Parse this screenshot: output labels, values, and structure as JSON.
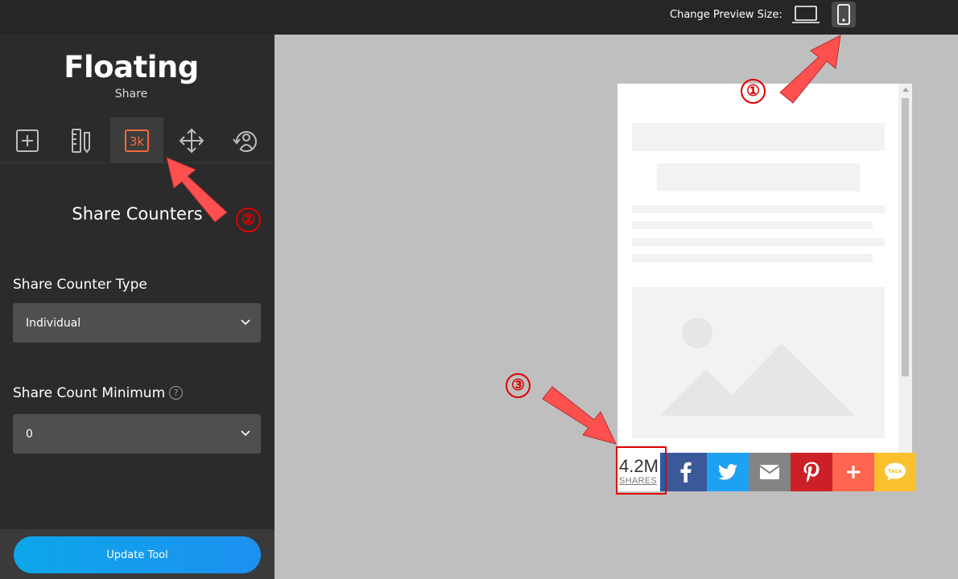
{
  "topbar": {
    "preview_label": "Change Preview Size:",
    "devices": [
      {
        "name": "laptop",
        "icon": "laptop-icon"
      },
      {
        "name": "mobile",
        "icon": "mobile-icon",
        "active": true
      }
    ]
  },
  "sidebar": {
    "title": "Floating",
    "subtitle": "Share",
    "tabs": [
      {
        "icon": "add-box-icon"
      },
      {
        "icon": "ruler-pencil-icon"
      },
      {
        "icon": "counter-3k-icon",
        "label": "3k",
        "active": true
      },
      {
        "icon": "move-arrows-icon"
      },
      {
        "icon": "user-refresh-icon"
      }
    ],
    "section_title": "Share Counters",
    "fields": [
      {
        "label": "Share Counter Type",
        "value": "Individual"
      },
      {
        "label": "Share Count Minimum",
        "value": "0",
        "help": "?"
      }
    ],
    "update_button": "Update Tool"
  },
  "share_bar": {
    "counter_value": "4.2M",
    "counter_label": "SHARES",
    "buttons": [
      {
        "name": "facebook",
        "icon": "facebook-icon",
        "color": "#3b5998"
      },
      {
        "name": "twitter",
        "icon": "twitter-icon",
        "color": "#1da1f2"
      },
      {
        "name": "email",
        "icon": "email-icon",
        "color": "#848484"
      },
      {
        "name": "pinterest",
        "icon": "pinterest-icon",
        "color": "#cb2027"
      },
      {
        "name": "more",
        "icon": "plus-icon",
        "color": "#ff6550"
      },
      {
        "name": "kakaotalk",
        "icon": "kakaotalk-icon",
        "label": "TALK",
        "color": "#fbc02d"
      }
    ]
  },
  "annotations": [
    "①",
    "②",
    "③"
  ],
  "colors": {
    "accent": "#f26b3a",
    "annotation": "#e00000",
    "arrow": "#ff5050"
  }
}
